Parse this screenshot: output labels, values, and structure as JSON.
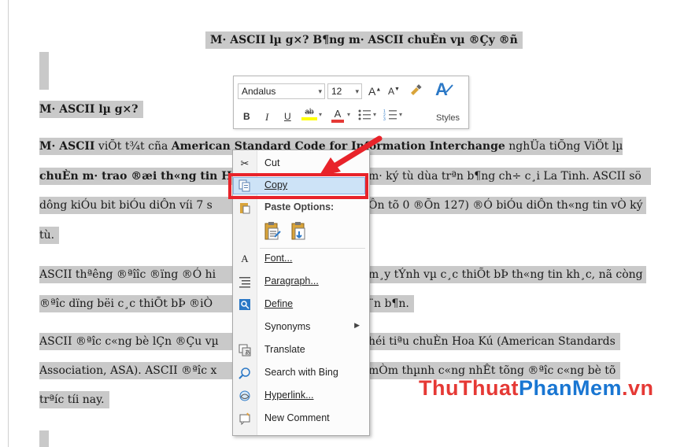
{
  "document": {
    "title": "M· ASCII lµ g×? B¶ng m· ASCII chuÈn vµ ®Çy ®ñ",
    "heading": "M· ASCII lµ g×?",
    "p1_l1_a": "M· ASCII",
    "p1_l1_b": " viÕt t¾t cña ",
    "p1_l1_c": "American Standard Code for Information Interchange",
    "p1_l1_d": " nghÜa tiÕng ViÖt lµ",
    "p1_l2_a": "chuÈn m· trao ®æi th«ng tin H",
    "p1_l2_b": "m· ký tù dùa trªn b¶ng ch÷ c¸i La Tinh. ASCII sö",
    "p1_l3_a": "dông kiÓu bit biÓu diÔn víi 7 s",
    "p1_l3_b": "Ôn tõ 0 ®Õn 127) ®Ó biÓu diÔn th«ng tin vÒ ký",
    "p1_l4": "tù.",
    "p2_l1_a": "ASCII thªêng ®ªîîc ®ïng ®Ó hi",
    "p2_l1_b": "m¸y tÝnh vµ c¸c thiÕt bÞ th«ng tin kh¸c, nã còng",
    "p2_l2_a": "®ªîc dïng bëi c¸c thiÕt bÞ ®iÒ",
    "p2_l2_b": "¨n b¶n.",
    "p3_l1_a": "ASCII ®ªîc c«ng bè lÇn ®Çu vµ",
    "p3_l1_b": "héi tiªu chuÈn Hoa Kú (American Standards",
    "p3_l2_a": "Association, ASA). ASCII ®ªîc x",
    "p3_l2_b": "mÒm thµnh c«ng nhÊt tõng ®ªîc c«ng bè tõ",
    "p3_l3": "trªíc tíi nay."
  },
  "mini_toolbar": {
    "font_name": "Andalus",
    "font_size": "12",
    "grow_font": "A",
    "shrink_font": "A",
    "bold": "B",
    "italic": "I",
    "underline": "U",
    "highlight": "ab",
    "font_color": "A",
    "styles_label": "Styles",
    "icons": {
      "format_painter": "format-painter-icon",
      "bullets": "bullets-icon",
      "numbering": "numbering-icon",
      "styles": "styles-icon"
    },
    "colors": {
      "highlight": "#ffff00",
      "font_color": "#e53935"
    }
  },
  "context_menu": {
    "cut": "Cut",
    "copy": "Copy",
    "paste_options": "Paste Options:",
    "font": "Font...",
    "paragraph": "Paragraph...",
    "define": "Define",
    "synonyms": "Synonyms",
    "translate": "Translate",
    "search_bing": "Search with Bing",
    "hyperlink": "Hyperlink...",
    "new_comment": "New Comment"
  },
  "watermark": {
    "part1": "ThuThuat",
    "part2": "PhanMem",
    "part3": ".vn"
  },
  "colors": {
    "selection": "#c9c9c9",
    "callout": "#e8232a",
    "menu_highlight": "#cde3f7"
  }
}
